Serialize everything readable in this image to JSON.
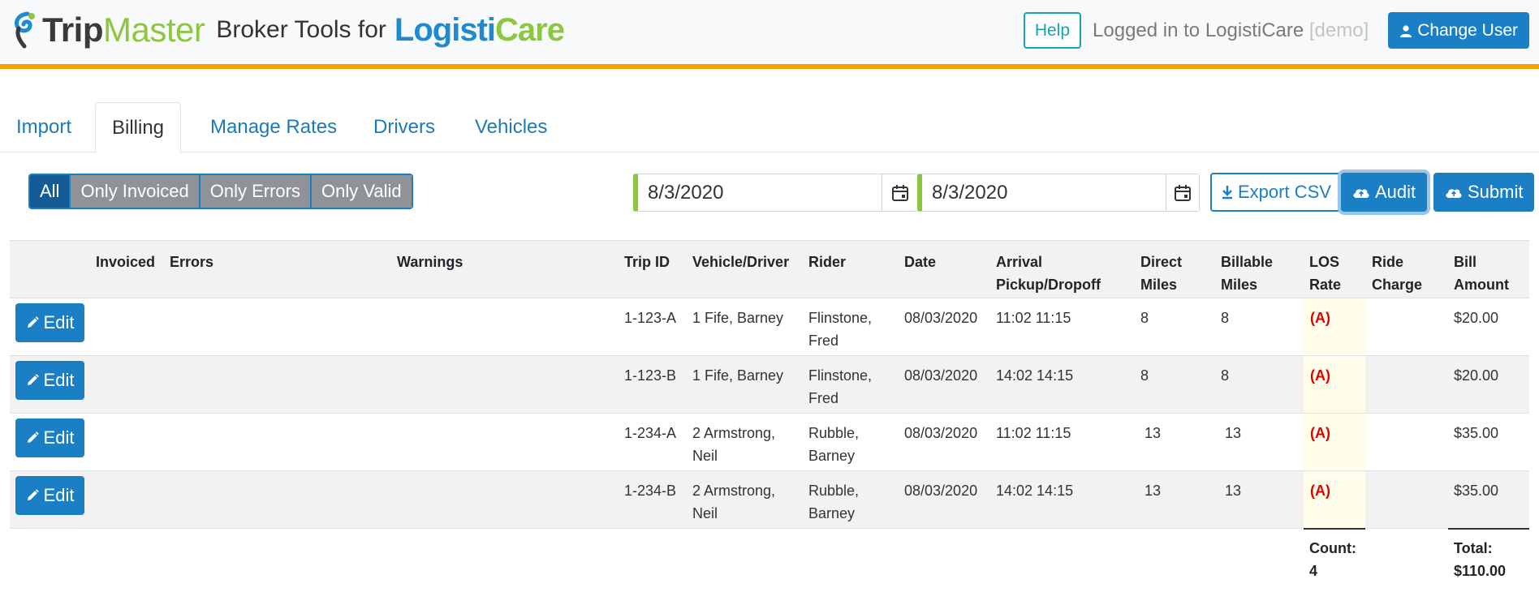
{
  "header": {
    "brand_trip": "Trip",
    "brand_master": "Master",
    "brand_tools": "Broker Tools for",
    "brand_logisti": "Logisti",
    "brand_care": "Care",
    "help_label": "Help",
    "logged_in_text": "Logged in to LogistiCare",
    "logged_in_demo": "[demo]",
    "change_user_label": "Change User"
  },
  "tabs": [
    {
      "label": "Import"
    },
    {
      "label": "Billing",
      "active": true
    },
    {
      "label": "Manage Rates"
    },
    {
      "label": "Drivers"
    },
    {
      "label": "Vehicles"
    }
  ],
  "filters": [
    {
      "label": "All",
      "active": true
    },
    {
      "label": "Only Invoiced"
    },
    {
      "label": "Only Errors"
    },
    {
      "label": "Only Valid"
    }
  ],
  "date_range": {
    "start": "8/3/2020",
    "end": "8/3/2020"
  },
  "actions": {
    "export_label": "Export CSV",
    "audit_label": "Audit",
    "submit_label": "Submit"
  },
  "table": {
    "columns": {
      "invoiced": "Invoiced",
      "errors": "Errors",
      "warnings": "Warnings",
      "trip_id": "Trip ID",
      "vehicle_driver": "Vehicle/Driver",
      "rider": "Rider",
      "date": "Date",
      "arrival_1": "Arrival",
      "arrival_2": "Pickup/Dropoff",
      "direct_1": "Direct",
      "direct_2": "Miles",
      "billable_1": "Billable",
      "billable_2": "Miles",
      "los_1": "LOS",
      "los_2": "Rate",
      "ride_1": "Ride",
      "ride_2": "Charge",
      "bill_1": "Bill",
      "bill_2": "Amount"
    },
    "edit_label": "Edit",
    "rows": [
      {
        "trip_id": "1-123-A",
        "vd_1": "1 Fife, Barney",
        "vd_2": "",
        "rider_1": "Flinstone,",
        "rider_2": "Fred",
        "date": "08/03/2020",
        "arrival": "11:02 11:15",
        "direct": "8",
        "billable": "8",
        "los": "(A)",
        "ride_charge": "",
        "bill": "$20.00"
      },
      {
        "trip_id": "1-123-B",
        "vd_1": "1 Fife, Barney",
        "vd_2": "",
        "rider_1": "Flinstone,",
        "rider_2": "Fred",
        "date": "08/03/2020",
        "arrival": "14:02 14:15",
        "direct": "8",
        "billable": "8",
        "los": "(A)",
        "ride_charge": "",
        "bill": "$20.00"
      },
      {
        "trip_id": "1-234-A",
        "vd_1": "2 Armstrong,",
        "vd_2": "Neil",
        "rider_1": "Rubble,",
        "rider_2": "Barney",
        "date": "08/03/2020",
        "arrival": "11:02 11:15",
        "direct": "13",
        "billable": "13",
        "los": "(A)",
        "ride_charge": "",
        "bill": "$35.00"
      },
      {
        "trip_id": "1-234-B",
        "vd_1": "2 Armstrong,",
        "vd_2": "Neil",
        "rider_1": "Rubble,",
        "rider_2": "Barney",
        "date": "08/03/2020",
        "arrival": "14:02 14:15",
        "direct": "13",
        "billable": "13",
        "los": "(A)",
        "ride_charge": "",
        "bill": "$35.00"
      }
    ],
    "footer": {
      "count_label": "Count:",
      "count_value": "4",
      "total_label": "Total:",
      "total_value": "$110.00"
    }
  },
  "colors": {
    "primary": "#1b7fc6",
    "accent_bar": "#f5a300",
    "brand_green": "#8dc63f",
    "los_text": "#e00000"
  }
}
